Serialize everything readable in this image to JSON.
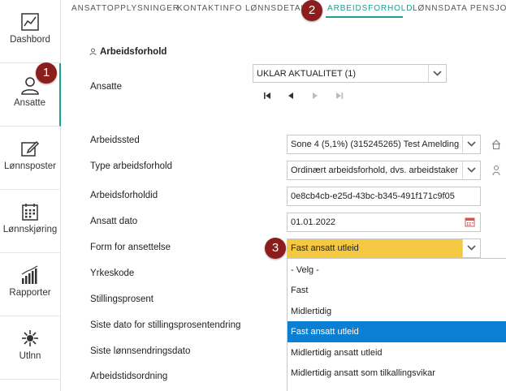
{
  "sidebar": {
    "items": [
      {
        "label": "Dashbord",
        "icon": "dashboard-icon"
      },
      {
        "label": "Ansatte",
        "icon": "user-icon"
      },
      {
        "label": "Lønnsposter",
        "icon": "edit-icon"
      },
      {
        "label": "Lønnskjøring",
        "icon": "calendar-icon"
      },
      {
        "label": "Rapporter",
        "icon": "bar-chart-icon"
      },
      {
        "label": "Utlnn",
        "icon": "settings-icon"
      }
    ]
  },
  "tabs": {
    "items": [
      "ANSATTOPPLYSNINGER",
      "KONTAKTINFO",
      "LØNNSDETAL",
      "ARBEIDSFORHOLD",
      "LØNNSDATA PENSJON"
    ],
    "active": "ARBEIDSFORHOLD"
  },
  "markers": {
    "m1": "1",
    "m2": "2",
    "m3": "3"
  },
  "form": {
    "section_title": "Arbeidsforhold",
    "ansatte_label": "Ansatte",
    "ansatte_value": "UKLAR AKTUALITET  (1)",
    "labels": {
      "arbeidssted": "Arbeidssted",
      "type": "Type arbeidsforhold",
      "arbeidsforholdid": "Arbeidsforholdid",
      "ansatt_dato": "Ansatt dato",
      "form": "Form for ansettelse",
      "yrkeskode": "Yrkeskode",
      "stillingsprosent": "Stillingsprosent",
      "siste_stilling": "Siste dato for stillingsprosentendring",
      "siste_lonn": "Siste lønnsendringsdato",
      "arbeidstid": "Arbeidstidsordning"
    },
    "values": {
      "arbeidssted": "Sone 4 (5,1%) (315245265) Test Amelding",
      "type": "Ordinært arbeidsforhold, dvs. arbeidstaker",
      "arbeidsforholdid": "0e8cb4cb-e25d-43bc-b345-491f171c9f05",
      "ansatt_dato": "01.01.2022",
      "form": "Fast ansatt utleid"
    }
  },
  "dropdown": {
    "options": [
      "- Velg -",
      "Fast",
      "Midlertidig",
      "Fast ansatt utleid",
      "Midlertidig ansatt utleid",
      "Midlertidig ansatt som tilkallingsvikar"
    ],
    "selected_index": 3
  },
  "colors": {
    "accent": "#1aa08f",
    "marker": "#8c1d1d",
    "highlight": "#f5c842",
    "selected": "#0a7fd4"
  }
}
